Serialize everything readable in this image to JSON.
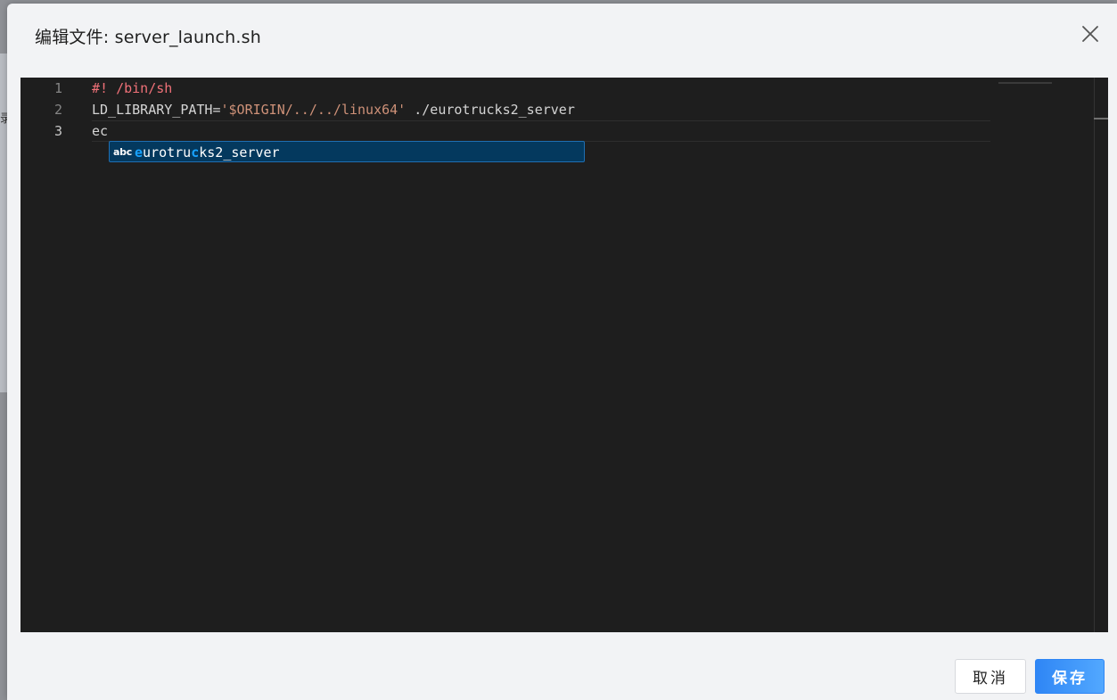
{
  "backdrop": {
    "glyph": "录"
  },
  "dialog": {
    "title": "编辑文件: server_launch.sh",
    "close_icon": "close-icon"
  },
  "editor": {
    "lines": [
      {
        "number": "1",
        "tokens": [
          {
            "type": "comment",
            "text": "#! /bin/sh"
          }
        ]
      },
      {
        "number": "2",
        "tokens": [
          {
            "type": "plain",
            "text": "LD_LIBRARY_PATH="
          },
          {
            "type": "string",
            "text": "'$ORIGIN/../../linux64'"
          },
          {
            "type": "plain",
            "text": " ./eurotrucks2_server"
          }
        ]
      },
      {
        "number": "3",
        "tokens": [
          {
            "type": "plain",
            "text": "ec"
          }
        ]
      }
    ],
    "suggestion": {
      "kind_label": "abc",
      "label_parts": [
        {
          "text": "e",
          "match": true
        },
        {
          "text": "urotru",
          "match": false
        },
        {
          "text": "c",
          "match": true
        },
        {
          "text": "ks2_server",
          "match": false
        }
      ]
    }
  },
  "footer": {
    "cancel_label": "取消",
    "save_label": "保存"
  },
  "colors": {
    "save_button": "#2f86f5",
    "suggest_bg": "#04395e",
    "comment": "#f07178",
    "string": "#ce9178"
  }
}
